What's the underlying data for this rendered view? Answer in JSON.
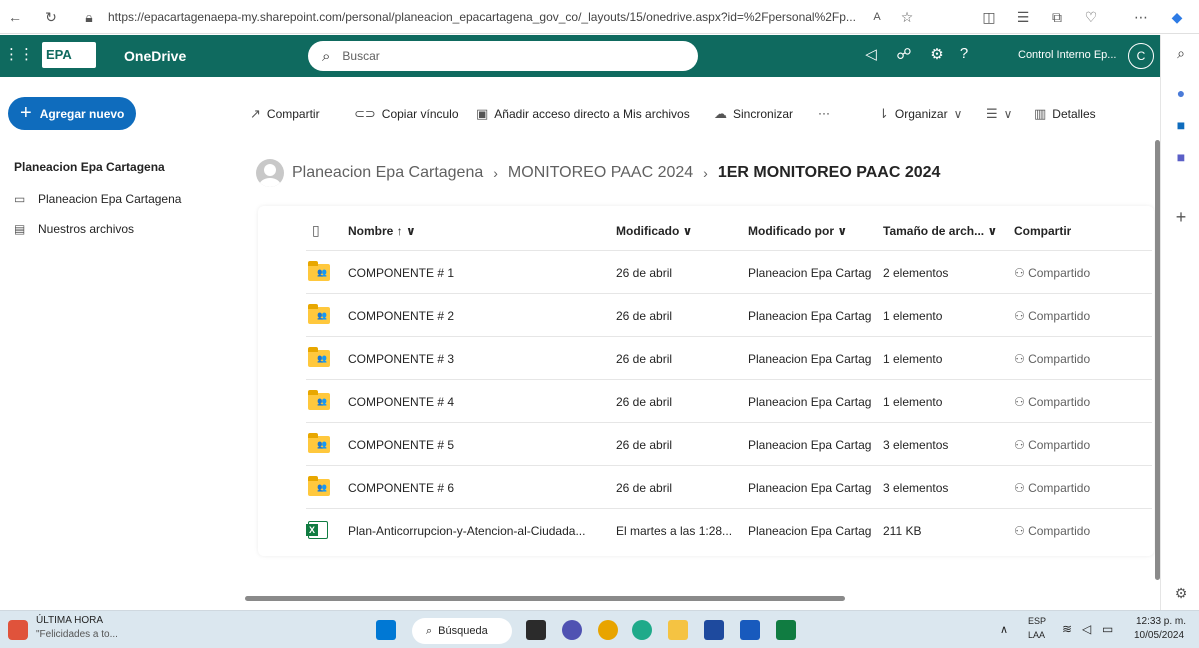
{
  "browser": {
    "url": "https://epacartagenaepa-my.sharepoint.com/personal/planeacion_epacartagena_gov_co/_layouts/15/onedrive.aspx?id=%2Fpersonal%2Fp..."
  },
  "header": {
    "logo": "EPA",
    "app_name": "OneDrive",
    "search_placeholder": "Buscar",
    "account_name": "Control Interno Ep...",
    "avatar_initial": "C",
    "help": "?"
  },
  "sidebar": {
    "new_button": "Agregar nuevo",
    "section_title": "Planeacion Epa Cartagena",
    "items": [
      {
        "label": "Planeacion Epa Cartagena"
      },
      {
        "label": "Nuestros archivos"
      }
    ]
  },
  "toolbar": {
    "share": "Compartir",
    "copy_link": "Copiar vínculo",
    "add_shortcut": "Añadir acceso directo a Mis archivos",
    "sync": "Sincronizar",
    "more": "···",
    "organize": "Organizar",
    "details": "Detalles"
  },
  "breadcrumb": {
    "items": [
      "Planeacion Epa Cartagena",
      "MONITOREO PAAC 2024",
      "1ER MONITOREO PAAC 2024"
    ]
  },
  "table": {
    "columns": {
      "name": "Nombre ↑ ∨",
      "modified": "Modificado ∨",
      "modified_by": "Modificado por ∨",
      "size": "Tamaño de arch... ∨",
      "share": "Compartir"
    },
    "rows": [
      {
        "name": "COMPONENTE # 1",
        "modified": "26 de abril",
        "modified_by": "Planeacion Epa Cartag",
        "size": "2 elementos",
        "share": "Compartido",
        "type": "folder"
      },
      {
        "name": "COMPONENTE # 2",
        "modified": "26 de abril",
        "modified_by": "Planeacion Epa Cartag",
        "size": "1 elemento",
        "share": "Compartido",
        "type": "folder"
      },
      {
        "name": "COMPONENTE # 3",
        "modified": "26 de abril",
        "modified_by": "Planeacion Epa Cartag",
        "size": "1 elemento",
        "share": "Compartido",
        "type": "folder"
      },
      {
        "name": "COMPONENTE # 4",
        "modified": "26 de abril",
        "modified_by": "Planeacion Epa Cartag",
        "size": "1 elemento",
        "share": "Compartido",
        "type": "folder"
      },
      {
        "name": "COMPONENTE # 5",
        "modified": "26 de abril",
        "modified_by": "Planeacion Epa Cartag",
        "size": "3 elementos",
        "share": "Compartido",
        "type": "folder"
      },
      {
        "name": "COMPONENTE # 6",
        "modified": "26 de abril",
        "modified_by": "Planeacion Epa Cartag",
        "size": "3 elementos",
        "share": "Compartido",
        "type": "folder"
      },
      {
        "name": "Plan-Anticorrupcion-y-Atencion-al-Ciudada...",
        "modified": "El martes a las 1:28...",
        "modified_by": "Planeacion Epa Cartag",
        "size": "211 KB",
        "share": "Compartido",
        "type": "excel"
      }
    ]
  },
  "taskbar": {
    "news_title": "ÚLTIMA HORA",
    "news_text": "\"Felicidades a to...",
    "search": "Búsqueda",
    "lang": "ESP",
    "lang_sub": "LAA",
    "time": "12:33 p. m.",
    "date": "10/05/2024"
  },
  "colors": {
    "suite": "#0f6a5f",
    "accent": "#0f6cbd",
    "folder": "#ffc83d",
    "excel": "#107c41"
  }
}
